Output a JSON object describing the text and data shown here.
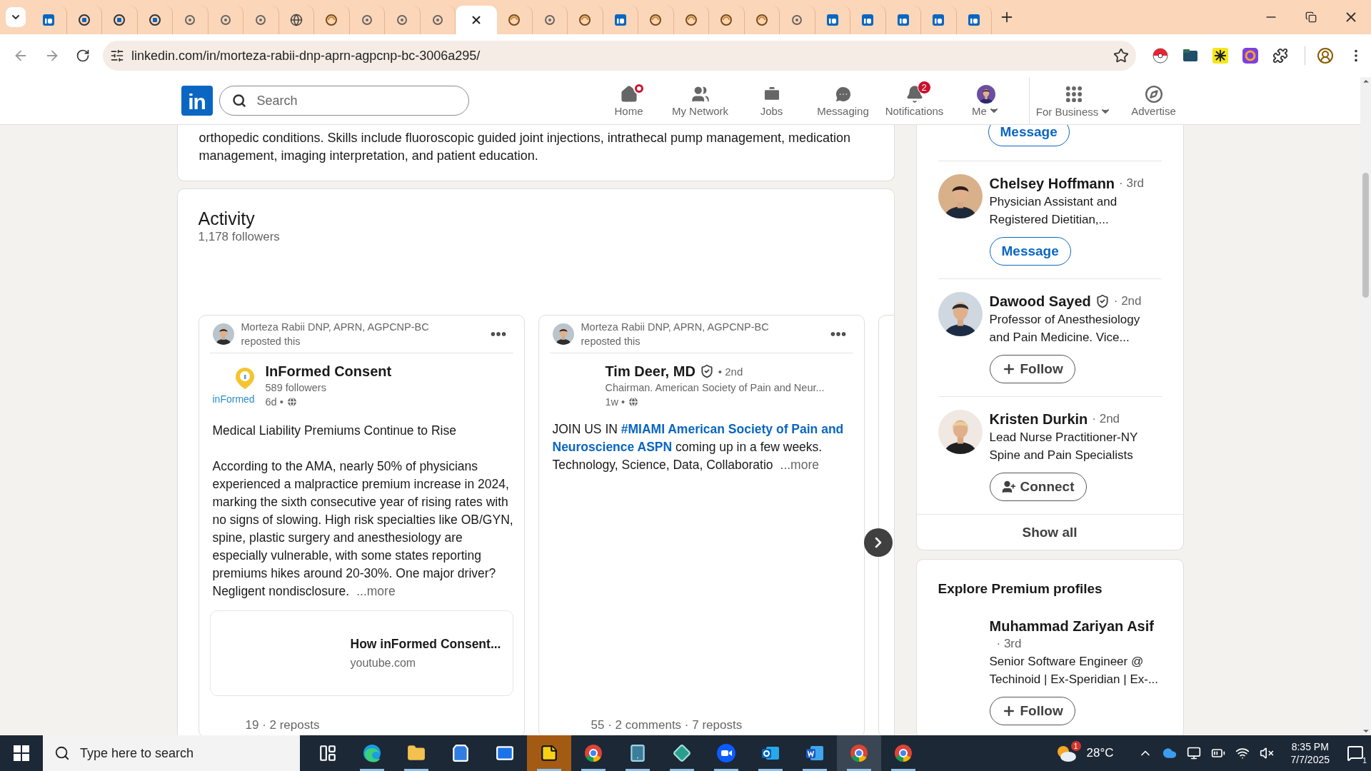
{
  "browser": {
    "tabs": [
      {
        "kind": "square",
        "selected": false
      },
      {
        "kind": "ring",
        "selected": false
      },
      {
        "kind": "ring",
        "selected": false
      },
      {
        "kind": "ring",
        "selected": false
      },
      {
        "kind": "dot",
        "selected": false
      },
      {
        "kind": "dot",
        "selected": false
      },
      {
        "kind": "dot",
        "selected": false
      },
      {
        "kind": "globe",
        "selected": false
      },
      {
        "kind": "swirl",
        "selected": false
      },
      {
        "kind": "dot",
        "selected": false
      },
      {
        "kind": "dot",
        "selected": false
      },
      {
        "kind": "dot",
        "selected": false
      },
      {
        "kind": "blank",
        "selected": true
      },
      {
        "kind": "swirl",
        "selected": false
      },
      {
        "kind": "dot",
        "selected": false
      },
      {
        "kind": "swirl",
        "selected": false
      },
      {
        "kind": "square",
        "selected": false
      },
      {
        "kind": "swirl",
        "selected": false
      },
      {
        "kind": "swirl",
        "selected": false
      },
      {
        "kind": "swirl",
        "selected": false
      },
      {
        "kind": "swirl",
        "selected": false
      },
      {
        "kind": "dot",
        "selected": false
      },
      {
        "kind": "square",
        "selected": false
      },
      {
        "kind": "square",
        "selected": false
      },
      {
        "kind": "square",
        "selected": false
      },
      {
        "kind": "square",
        "selected": false
      },
      {
        "kind": "square",
        "selected": false
      }
    ],
    "url": "linkedin.com/in/morteza-rabii-dnp-aprn-agpcnp-bc-3006a295/",
    "extensions": [
      {
        "kind": "ball"
      },
      {
        "kind": "folder"
      },
      {
        "kind": "spark"
      },
      {
        "kind": "ring"
      },
      {
        "kind": "puzzle"
      }
    ]
  },
  "nav": {
    "logo": "in",
    "search_placeholder": "Search",
    "items": [
      {
        "label": "Home",
        "dot": true
      },
      {
        "label": "My Network"
      },
      {
        "label": "Jobs"
      },
      {
        "label": "Messaging"
      },
      {
        "label": "Notifications",
        "count": "2"
      },
      {
        "label": "Me",
        "caret": true
      },
      {
        "label": "For Business",
        "caret": true,
        "divider": true
      },
      {
        "label": "Advertise"
      }
    ]
  },
  "about": {
    "lines": [
      "orthopedic conditions. Skills include fluoroscopic guided joint injections, intrathecal pump management, medication",
      "management, imaging interpretation, and patient education."
    ]
  },
  "activity": {
    "title": "Activity",
    "followers": "1,178 followers",
    "posts": [
      {
        "reposter": "Morteza Rabii DNP, APRN, AGPCNP-BC",
        "repost_note": "reposted this",
        "author": {
          "kind": "company",
          "name": "InFormed Consent",
          "logo_text": "inFormed",
          "subtitle": "589 followers",
          "time": "6d •"
        },
        "headline": "Medical Liability Premiums Continue to Rise",
        "body": [
          [
            {
              "text": "According to the AMA, nearly 50% of physicians"
            }
          ],
          [
            {
              "text": "experienced a malpractice premium increase in 2024,"
            }
          ],
          [
            {
              "text": "marking the sixth consecutive year of rising rates with"
            }
          ],
          [
            {
              "text": "no signs of slowing. High risk specialties like OB/GYN,"
            }
          ],
          [
            {
              "text": "spine, plastic surgery and anesthesiology are"
            }
          ],
          [
            {
              "text": "especially vulnerable, with some states reporting"
            }
          ],
          [
            {
              "text": "premiums hikes around 20-30%. One major driver?"
            }
          ],
          [
            {
              "text": "Negligent nondisclosure."
            }
          ]
        ],
        "more": "...more",
        "preview": {
          "title": "How inFormed Consent...",
          "source": "youtube.com"
        },
        "stats": "19 · 2 reposts"
      },
      {
        "reposter": "Morteza Rabii DNP, APRN, AGPCNP-BC",
        "repost_note": "reposted this",
        "author": {
          "kind": "person",
          "name": "Tim Deer, MD",
          "verified": true,
          "degree": "• 2nd",
          "subtitle": "Chairman. American Society of Pain and Neur...",
          "time": "1w •"
        },
        "body": [
          [
            {
              "text": "JOIN US IN "
            },
            {
              "text": "#MIAMI American Society of Pain and",
              "link": true
            }
          ],
          [
            {
              "text": "Neuroscience ASPN",
              "link": true
            },
            {
              "text": " coming up in a few weeks."
            }
          ],
          [
            {
              "text": "Technology, Science, Data, Collaboratio"
            }
          ]
        ],
        "more": "...more",
        "stats": "55 · 2 comments · 7 reposts"
      }
    ]
  },
  "sidebar": {
    "top_action": {
      "kind": "message",
      "label": "Message"
    },
    "people": [
      {
        "name": "Chelsey Hoffmann",
        "degree": "· 3rd",
        "headline": [
          "Physician Assistant and",
          "Registered Dietitian,..."
        ],
        "action": {
          "kind": "message",
          "label": "Message"
        }
      },
      {
        "name": "Dawood Sayed",
        "verified": true,
        "degree": "· 2nd",
        "headline": [
          "Professor of Anesthesiology",
          "and Pain Medicine. Vice..."
        ],
        "action": {
          "kind": "follow",
          "label": "Follow"
        }
      },
      {
        "name": "Kristen Durkin",
        "degree": "· 2nd",
        "headline": [
          "Lead Nurse Practitioner-NY",
          "Spine and Pain Specialists"
        ],
        "action": {
          "kind": "connect",
          "label": "Connect"
        }
      }
    ],
    "show_all": "Show all",
    "premium": {
      "title": "Explore Premium profiles",
      "people": [
        {
          "name": "Muhammad Zariyan Asif",
          "degree": "· 3rd",
          "headline": [
            "Senior Software Engineer @",
            "Techinoid | Ex-Speridian | Ex-..."
          ],
          "action": {
            "kind": "follow",
            "label": "Follow"
          }
        }
      ]
    }
  },
  "taskbar": {
    "search_placeholder": "Type here to search",
    "apps": [
      {
        "kind": "taskview",
        "selected": false,
        "running": false
      },
      {
        "kind": "edge",
        "selected": false,
        "running": true
      },
      {
        "kind": "folder",
        "selected": false,
        "running": true
      },
      {
        "kind": "store",
        "selected": false,
        "running": false
      },
      {
        "kind": "mail",
        "selected": false,
        "running": false
      },
      {
        "kind": "notes",
        "selected": true,
        "running": true
      },
      {
        "kind": "chrome",
        "selected": false,
        "running": true
      },
      {
        "kind": "tablet",
        "selected": false,
        "running": true
      },
      {
        "kind": "diamond",
        "selected": false,
        "running": true
      },
      {
        "kind": "video",
        "selected": false,
        "running": true
      },
      {
        "kind": "outlook",
        "selected": false,
        "running": true
      },
      {
        "kind": "word",
        "selected": false,
        "running": true
      },
      {
        "kind": "chrome",
        "selected": true,
        "running": true
      },
      {
        "kind": "chrome",
        "selected": false,
        "running": true
      }
    ],
    "weather": {
      "badge": "1",
      "temperature": "28°C"
    },
    "time": "8:35 PM",
    "date": "7/7/2025",
    "notifications": "1"
  }
}
